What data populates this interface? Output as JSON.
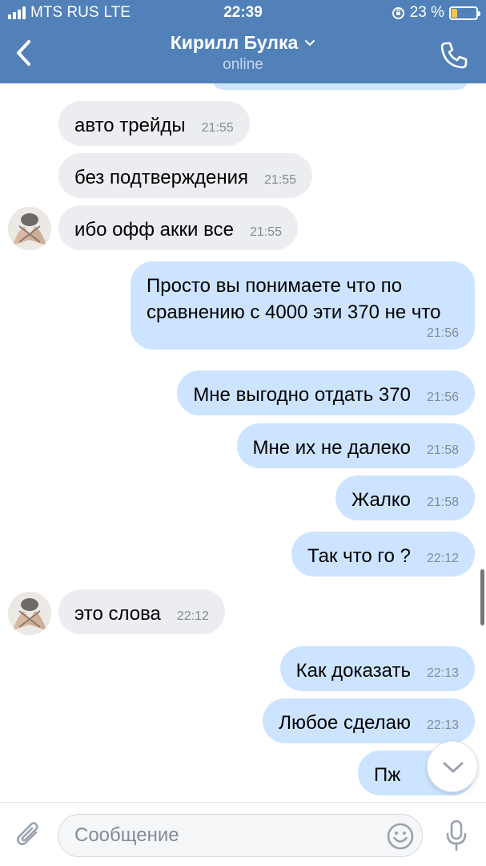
{
  "status_bar": {
    "carrier": "MTS RUS",
    "network": "LTE",
    "time": "22:39",
    "battery": "23 %",
    "battery_level": 0.23
  },
  "header": {
    "contact_name": "Кирилл Булка",
    "status": "online",
    "back_icon": "chevron-left-icon",
    "call_icon": "phone-icon"
  },
  "messages": [
    {
      "dir": "in",
      "text": "авто трейды",
      "time": "21:55"
    },
    {
      "dir": "in",
      "text": "без подтверждения",
      "time": "21:55"
    },
    {
      "dir": "in",
      "text": "ибо офф акки все",
      "time": "21:55"
    },
    {
      "dir": "out",
      "text": "Просто вы понимаете что по сравнению с 4000 эти 370 не что",
      "time": "21:56"
    },
    {
      "dir": "out",
      "text": "Мне выгодно отдать 370",
      "time": "21:56"
    },
    {
      "dir": "out",
      "text": "Мне их не далеко",
      "time": "21:58"
    },
    {
      "dir": "out",
      "text": "Жалко",
      "time": "21:58"
    },
    {
      "dir": "out",
      "text": "Так что го ?",
      "time": "22:12"
    },
    {
      "dir": "in",
      "text": "это слова",
      "time": "22:12"
    },
    {
      "dir": "out",
      "text": "Как доказать",
      "time": "22:13"
    },
    {
      "dir": "out",
      "text": "Любое сделаю",
      "time": "22:13"
    },
    {
      "dir": "out",
      "text": "Пж",
      "time": ""
    }
  ],
  "composer": {
    "placeholder": "Сообщение",
    "attach_icon": "paperclip-icon",
    "emoji_icon": "smiley-icon",
    "mic_icon": "microphone-icon"
  },
  "colors": {
    "header_bg": "#5181b8",
    "incoming_bubble": "#ebedf0",
    "outgoing_bubble": "#cce4ff",
    "timestamp": "#818c99"
  }
}
